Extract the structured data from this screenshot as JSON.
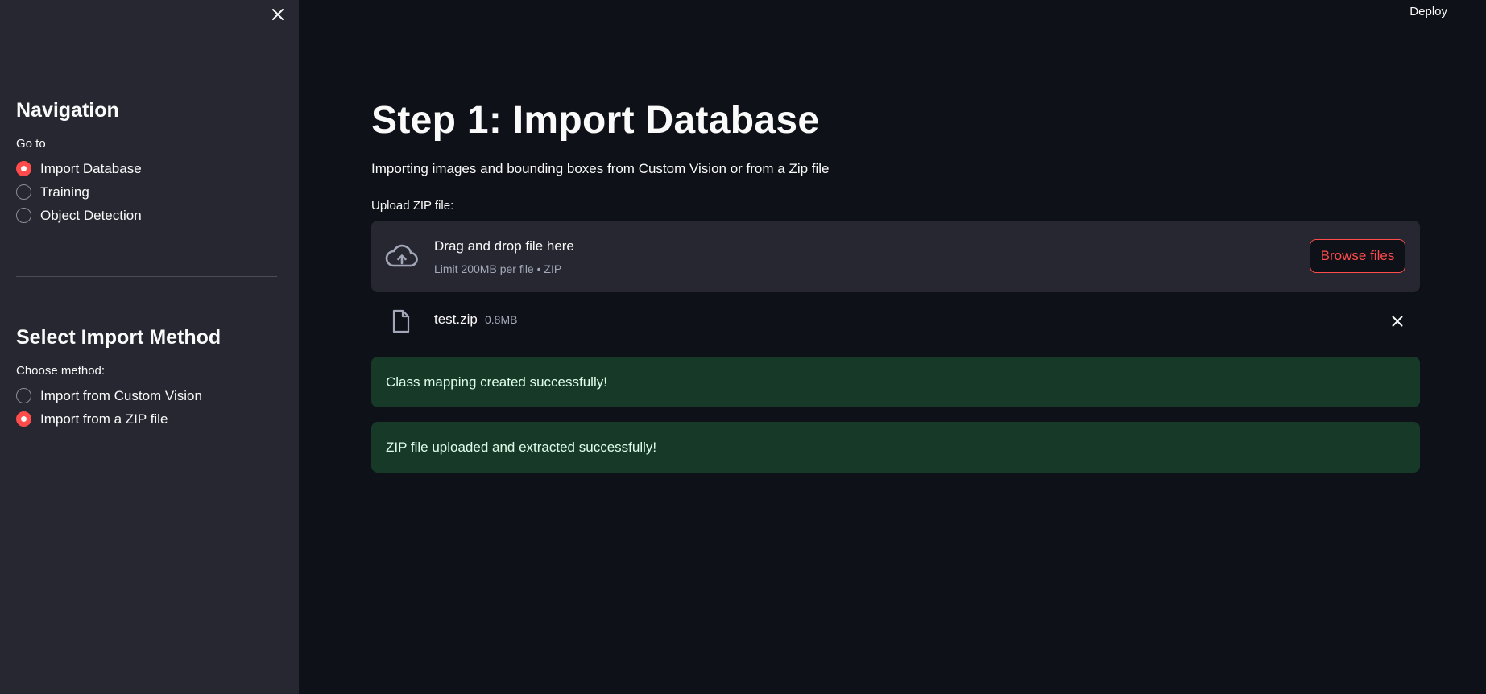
{
  "sidebar": {
    "navigation": {
      "heading": "Navigation",
      "label": "Go to",
      "options": [
        {
          "label": "Import Database",
          "checked": true
        },
        {
          "label": "Training",
          "checked": false
        },
        {
          "label": "Object Detection",
          "checked": false
        }
      ]
    },
    "import_method": {
      "heading": "Select Import Method",
      "label": "Choose method:",
      "options": [
        {
          "label": "Import from Custom Vision",
          "checked": false
        },
        {
          "label": "Import from a ZIP file",
          "checked": true
        }
      ]
    }
  },
  "header": {
    "deploy_label": "Deploy"
  },
  "main": {
    "title": "Step 1: Import Database",
    "subtitle": "Importing images and bounding boxes from Custom Vision or from a Zip file",
    "uploader": {
      "label": "Upload ZIP file:",
      "drop_text": "Drag and drop file here",
      "limit_text": "Limit 200MB per file • ZIP",
      "browse_label": "Browse files"
    },
    "file": {
      "name": "test.zip",
      "size": "0.8MB"
    },
    "alerts": [
      {
        "text": "Class mapping created successfully!"
      },
      {
        "text": "ZIP file uploaded and extracted successfully!"
      }
    ]
  },
  "colors": {
    "sidebar_bg": "#262730",
    "main_bg": "#0e1117",
    "accent": "#ff4b4b",
    "success_bg": "#173928"
  },
  "icons": [
    "close-icon",
    "cloud-upload-icon",
    "file-icon",
    "remove-file-icon",
    "radio-icon"
  ]
}
